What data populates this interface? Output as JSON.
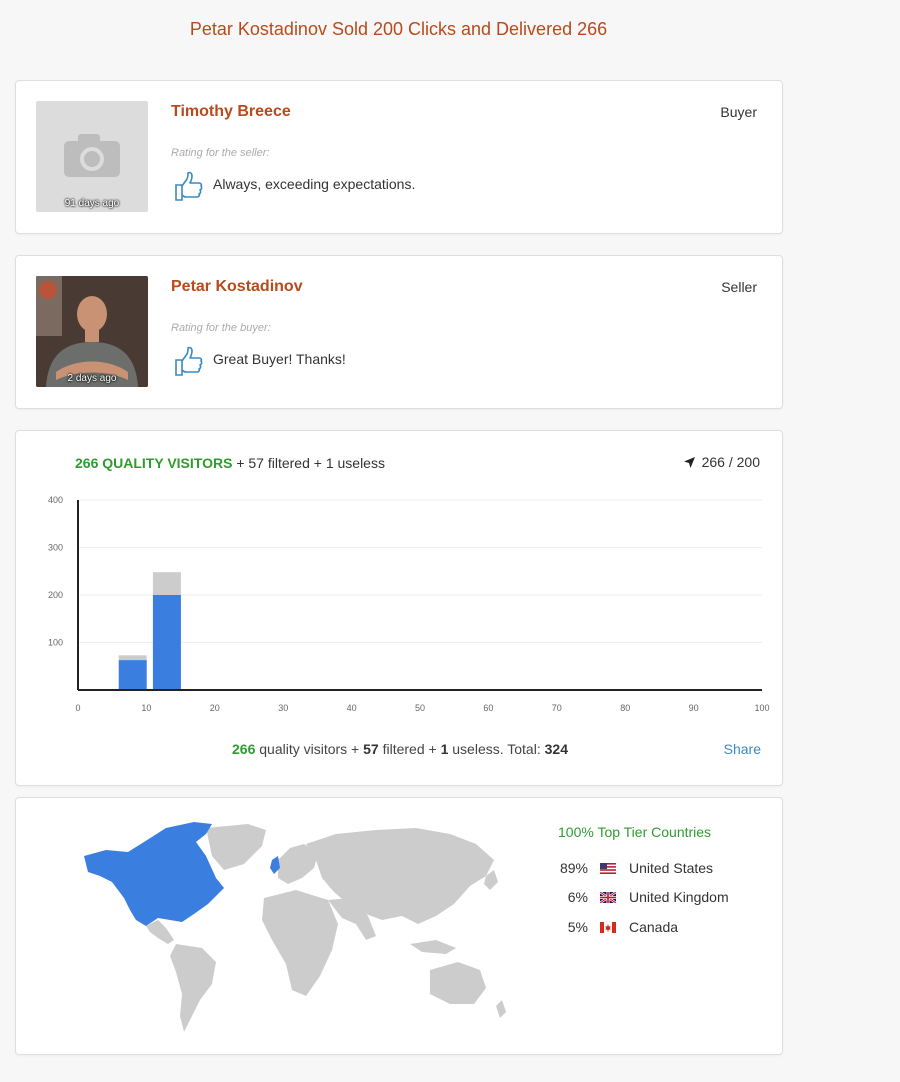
{
  "page": {
    "title": "Petar Kostadinov Sold 200 Clicks and Delivered 266"
  },
  "reviews": [
    {
      "name": "Timothy Breece",
      "role": "Buyer",
      "time_ago": "91 days ago",
      "rating_label": "Rating for the seller:",
      "text": "Always, exceeding expectations."
    },
    {
      "name": "Petar Kostadinov",
      "role": "Seller",
      "time_ago": "2 days ago",
      "rating_label": "Rating for the buyer:",
      "text": "Great Buyer! Thanks!"
    }
  ],
  "stats": {
    "quality_headline": "266 QUALITY VISITORS",
    "filtered_text": "+ 57 filtered + 1 useless",
    "clicks_counter": "266 / 200",
    "footer": {
      "quality": "266",
      "quality_label": "quality visitors +",
      "filtered": "57",
      "filtered_label": "filtered +",
      "useless": "1",
      "useless_label": "useless. Total:",
      "total": "324"
    },
    "share_label": "Share"
  },
  "chart_data": {
    "type": "bar",
    "stacked": true,
    "xlim": [
      0,
      100
    ],
    "ylim": [
      0,
      400
    ],
    "x_ticks": [
      "0",
      "10",
      "20",
      "30",
      "40",
      "50",
      "60",
      "70",
      "80",
      "90",
      "100"
    ],
    "y_ticks": [
      "100",
      "200",
      "300",
      "400"
    ],
    "grid": true,
    "x": [
      8,
      13
    ],
    "series": [
      {
        "color": "#3a7ee0",
        "values": [
          63,
          200
        ]
      },
      {
        "color": "#cccccc",
        "values": [
          10,
          48
        ]
      }
    ]
  },
  "countries": {
    "title": "100% Top Tier Countries",
    "items": [
      {
        "pct": "89%",
        "name": "United States",
        "flag": "us-flag-icon"
      },
      {
        "pct": "6%",
        "name": "United Kingdom",
        "flag": "uk-flag-icon"
      },
      {
        "pct": "5%",
        "name": "Canada",
        "flag": "canada-flag-icon"
      }
    ],
    "highlight_color": "#3a7ee0",
    "land_color": "#cccccc"
  }
}
